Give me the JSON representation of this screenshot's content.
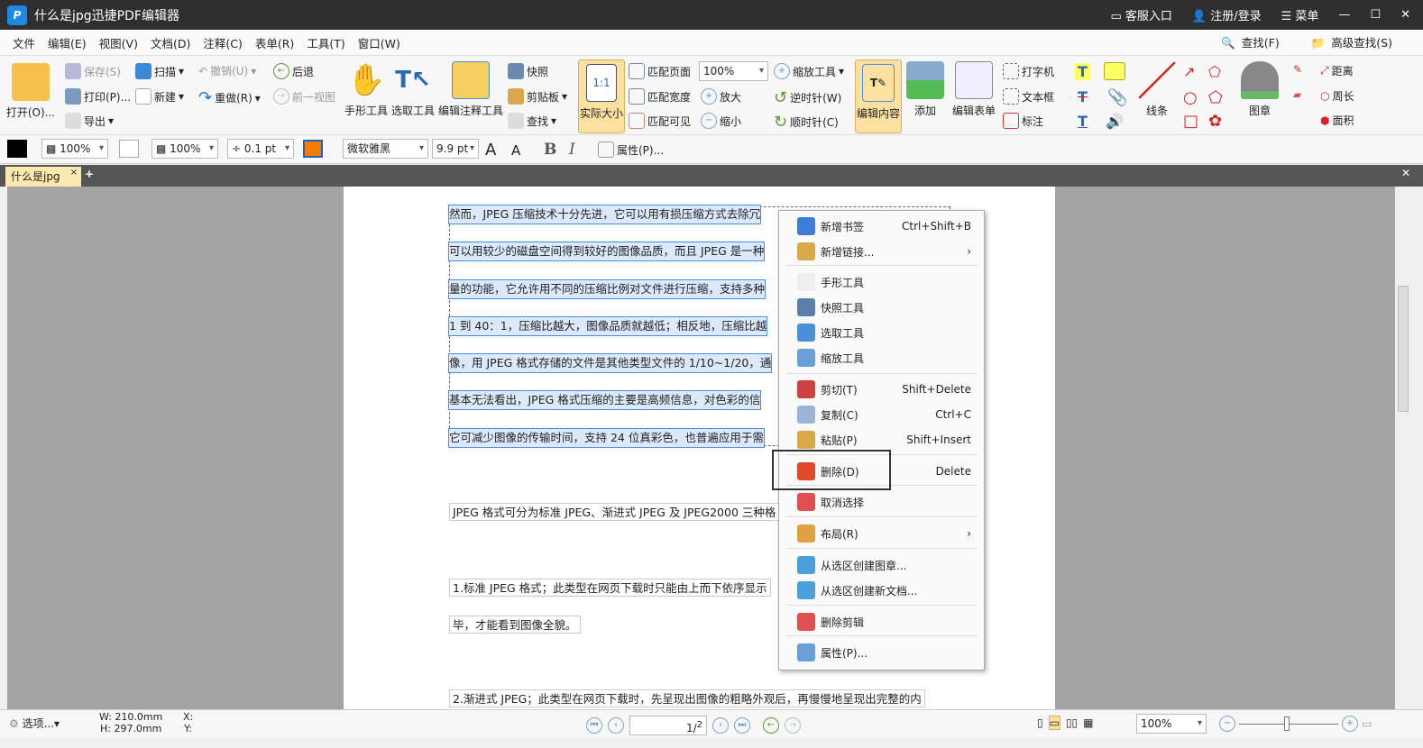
{
  "title": "什么是jpg迅捷PDF编辑器",
  "titlebar": {
    "service": "客服入口",
    "login": "注册/登录",
    "menu": "菜单"
  },
  "menubar": [
    "文件",
    "编辑(E)",
    "视图(V)",
    "文档(D)",
    "注释(C)",
    "表单(R)",
    "工具(T)",
    "窗口(W)"
  ],
  "menu_right": {
    "find": "查找(F)",
    "adv_find": "高级查找(S)"
  },
  "ribbon": {
    "open": "打开(O)...",
    "save": "保存(S)",
    "print": "打印(P)...",
    "export": "导出",
    "scan": "扫描",
    "new": "新建",
    "undo": "撤销(U)",
    "redo": "重做(R)",
    "back": "后退",
    "prev_view": "前一视图",
    "hand": "手形工具",
    "select": "选取工具",
    "edit_annot": "编辑注释工具",
    "snapshot": "快照",
    "clipboard": "剪贴板",
    "find": "查找",
    "actual": "实际大小",
    "fit_page": "匹配页面",
    "fit_width": "匹配宽度",
    "fit_visible": "匹配可见",
    "zoom_value": "100%",
    "zoom_in": "放大",
    "zoom_out": "缩小",
    "zoom_tool": "缩放工具",
    "ccw": "逆时针(W)",
    "cw": "顺时针(C)",
    "edit_content": "编辑内容",
    "add": "添加",
    "edit_form": "编辑表单",
    "typewriter": "打字机",
    "textbox": "文本框",
    "callout": "标注",
    "lines": "线条",
    "stamp": "图章",
    "distance": "距离",
    "perimeter": "周长",
    "area": "面积"
  },
  "format": {
    "fill_opacity": "100%",
    "stroke_opacity": "100%",
    "line_width": "0.1 pt",
    "font": "微软雅黑",
    "font_size": "9.9 pt",
    "properties": "属性(P)..."
  },
  "tab": {
    "name": "什么是jpg"
  },
  "document": {
    "lines": [
      "然而，JPEG 压缩技术十分先进，它可以用有损压缩方式去除冗",
      "可以用较少的磁盘空间得到较好的图像品质，而且 JPEG 是一种",
      "量的功能，它允许用不同的压缩比例对文件进行压缩，支持多种",
      "1 到 40：1，压缩比越大，图像品质就越低；相反地，压缩比越",
      "像，用 JPEG 格式存储的文件是其他类型文件的 1/10~1/20，通",
      "基本无法看出，JPEG 格式压缩的主要是高频信息，对色彩的信",
      "它可减少图像的传输时间，支持 24 位真彩色，也普遍应用于需"
    ],
    "p2": "JPEG 格式可分为标准 JPEG、渐进式 JPEG 及 JPEG2000 三种格",
    "p3a": "1.标准 JPEG 格式；此类型在网页下载时只能由上而下依序显示",
    "p3b": "毕，才能看到图像全貌。",
    "p4": "2.渐进式 JPEG；此类型在网页下载时，先呈现出图像的粗略外观后，再慢慢地呈现出完整的内"
  },
  "context_menu": [
    {
      "label": "新增书签",
      "shortcut": "Ctrl+Shift+B",
      "color": "#3b7dd8"
    },
    {
      "label": "新增链接...",
      "submenu": true,
      "color": "#d9a84a"
    },
    {
      "label": "手形工具",
      "color": "#eeeeee"
    },
    {
      "label": "快照工具",
      "color": "#5a7fa8"
    },
    {
      "label": "选取工具",
      "color": "#4a90d9"
    },
    {
      "label": "缩放工具",
      "color": "#6aa0d8"
    },
    {
      "label": "剪切(T)",
      "shortcut": "Shift+Delete",
      "color": "#d04040"
    },
    {
      "label": "复制(C)",
      "shortcut": "Ctrl+C",
      "color": "#9ab4d8"
    },
    {
      "label": "粘贴(P)",
      "shortcut": "Shift+Insert",
      "color": "#d9a84a"
    },
    {
      "label": "删除(D)",
      "shortcut": "Delete",
      "color": "#e04a2a"
    },
    {
      "label": "取消选择",
      "color": "#e05050"
    },
    {
      "label": "布局(R)",
      "submenu": true,
      "color": "#e0a040"
    },
    {
      "label": "从选区创建图章...",
      "color": "#4aa0d8"
    },
    {
      "label": "从选区创建新文档...",
      "color": "#4aa0d8"
    },
    {
      "label": "删除剪辑",
      "color": "#e05050"
    },
    {
      "label": "属性(P)...",
      "color": "#6aa0d8"
    }
  ],
  "statusbar": {
    "options": "选项...",
    "width": "W: 210.0mm",
    "height": "H: 297.0mm",
    "x": "X:",
    "y": "Y:",
    "page": "1",
    "pages": "2",
    "zoom": "100%"
  }
}
